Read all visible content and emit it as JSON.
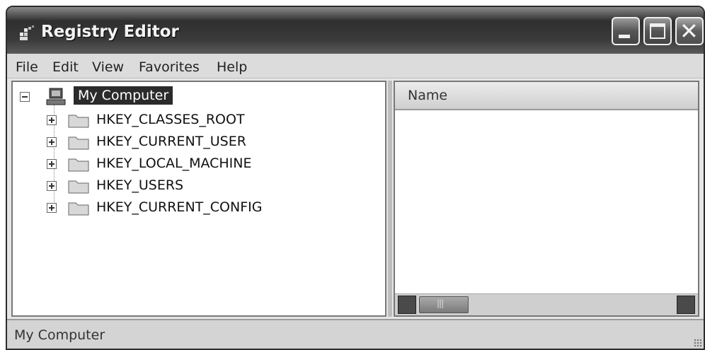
{
  "window": {
    "title": "Registry Editor"
  },
  "menu": [
    "File",
    "Edit",
    "View",
    "Favorites",
    "Help"
  ],
  "tree": {
    "root": "My Computer",
    "keys": [
      "HKEY_CLASSES_ROOT",
      "HKEY_CURRENT_USER",
      "HKEY_LOCAL_MACHINE",
      "HKEY_USERS",
      "HKEY_CURRENT_CONFIG"
    ]
  },
  "list": {
    "columns": [
      "Name"
    ]
  },
  "status": {
    "text": "My Computer"
  },
  "icons": {
    "app": "registry-editor-icon",
    "root": "computer-icon",
    "key": "folder-icon",
    "minimize": "minimize-icon",
    "maximize": "maximize-icon",
    "close": "close-icon"
  }
}
